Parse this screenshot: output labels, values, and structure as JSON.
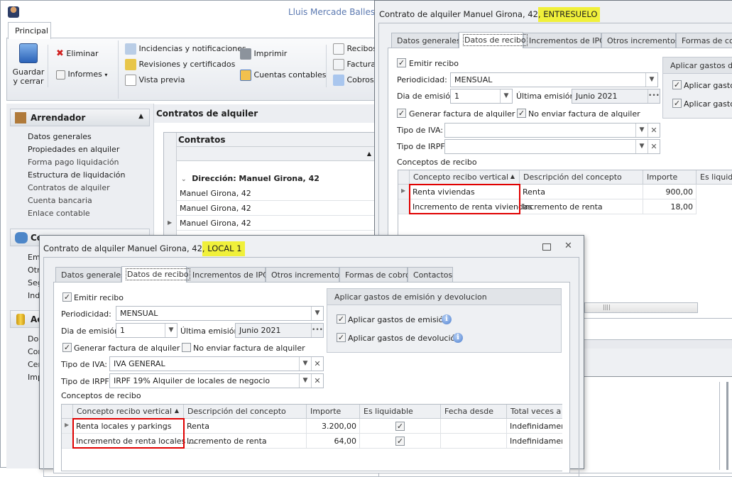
{
  "app": {
    "user": "Lluis Mercade Ballesteros",
    "ribbon_tab": "Principal"
  },
  "ribbon": {
    "save": "Guardar",
    "save2": "y cerrar",
    "delete": "Eliminar",
    "reports": "Informes",
    "incidents": "Incidencias y notificaciones",
    "revisions": "Revisiones y certificados",
    "preview": "Vista previa",
    "print": "Imprimir",
    "accounts": "Cuentas contables",
    "receipts": "Recibos",
    "invoices": "Facturas",
    "payments": "Cobros/"
  },
  "sidebar": {
    "group1": {
      "title": "Arrendador",
      "items": [
        "Datos generales",
        "Propiedades en alquiler",
        "Forma pago liquidación",
        "Estructura de liquidación",
        "Contratos de alquiler",
        "Cuenta bancaria",
        "Enlace contable"
      ]
    },
    "group2": {
      "title": "Co",
      "items": [
        "Em",
        "Otr",
        "Seg",
        "Ind"
      ]
    },
    "group3": {
      "title": "Ac",
      "items": [
        "Doc",
        "Cor",
        "Cer",
        "Imp"
      ]
    }
  },
  "content": {
    "title": "Contratos de alquiler",
    "grid_header": "Contratos",
    "group_row": "Dirección: Manuel Girona, 42",
    "rows": [
      "Manuel Girona, 42",
      "Manuel Girona, 42",
      "Manuel Girona, 42"
    ]
  },
  "dialog1": {
    "title_prefix": "Contrato de alquiler Manuel Girona, 42",
    "title_highlight": ", ENTRESUELO",
    "tabs": [
      "Datos generales",
      "Datos de recibo",
      "Incrementos de IPC",
      "Otros incrementos",
      "Formas de cobr"
    ],
    "emitir": "Emitir recibo",
    "periodicidad_label": "Periodicidad:",
    "periodicidad": "MENSUAL",
    "dia_label": "Dia de emisión:",
    "dia": "1",
    "ultima_label": "Última emisión:",
    "ultima": "Junio 2021",
    "generar": "Generar factura de alquiler",
    "no_enviar": "No enviar factura de alquiler",
    "iva_label": "Tipo de IVA:",
    "iva": "",
    "irpf_label": "Tipo de IRPF:",
    "irpf": "",
    "conceptos": "Conceptos de recibo",
    "gbox_title": "Aplicar gastos de e",
    "gbox_cb1": "Aplicar gastos",
    "gbox_cb2": "Aplicar gastos",
    "columns": [
      "Concepto recibo vertical",
      "Descripción del concepto",
      "Importe",
      "Es liquidab"
    ],
    "rows": [
      [
        "Renta viviendas",
        "Renta",
        "900,00"
      ],
      [
        "Incremento de renta viviendas",
        "Incremento de renta",
        "18,00"
      ]
    ]
  },
  "dialog2": {
    "title_prefix": "Contrato de alquiler Manuel Girona, 42",
    "title_highlight": ", LOCAL 1",
    "tabs": [
      "Datos generales",
      "Datos de recibo",
      "Incrementos de IPC",
      "Otros incrementos",
      "Formas de cobro",
      "Contactos"
    ],
    "emitir": "Emitir recibo",
    "periodicidad_label": "Periodicidad:",
    "periodicidad": "MENSUAL",
    "dia_label": "Dia de emisión:",
    "dia": "1",
    "ultima_label": "Última emisión:",
    "ultima": "Junio 2021",
    "generar": "Generar factura de alquiler",
    "no_enviar": "No enviar factura de alquiler",
    "iva_label": "Tipo de IVA:",
    "iva": "IVA GENERAL",
    "irpf_label": "Tipo de IRPF:",
    "irpf": "IRPF 19% Alquiler de locales de negocio",
    "conceptos": "Conceptos de recibo",
    "gbox_title": "Aplicar gastos de emisión y devolucion",
    "gbox_cb1": "Aplicar gastos de emisión",
    "gbox_cb2": "Aplicar gastos de devolución",
    "columns": [
      "Concepto recibo vertical",
      "Descripción del concepto",
      "Importe",
      "Es liquidable",
      "Fecha desde",
      "Total veces a e"
    ],
    "rows": [
      [
        "Renta locales y parkings",
        "Renta",
        "3.200,00",
        "",
        "Indefinidament"
      ],
      [
        "Incremento de renta locales ...",
        "Incremento de renta",
        "64,00",
        "",
        "Indefinidament"
      ]
    ]
  },
  "colors": {
    "highlight": "#f0f03a",
    "red_box": "#e00000",
    "user_name": "#5a78b0"
  }
}
